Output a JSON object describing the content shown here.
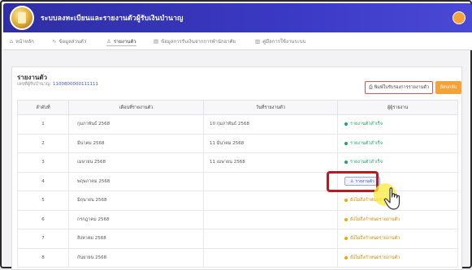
{
  "app": {
    "title": "ระบบลงทะเบียนและรายงานตัวผู้รับเงินบำนาญ"
  },
  "nav": {
    "items": [
      {
        "label": "หน้าหลัก",
        "icon": "home-icon",
        "glyph": "⌂"
      },
      {
        "label": "ข้อมูลส่วนตัว",
        "icon": "user-icon",
        "glyph": "∿"
      },
      {
        "label": "รายงานตัว",
        "icon": "person-icon",
        "glyph": "♙"
      },
      {
        "label": "ข้อมูลการรับเงินจากการพำนักอาศัย",
        "icon": "document-icon",
        "glyph": "▤"
      },
      {
        "label": "คู่มือการใช้งานระบบ",
        "icon": "book-icon",
        "glyph": "▥"
      }
    ]
  },
  "page": {
    "title": "รายงานตัว",
    "subtitle_prefix": "เลขที่ผู้รับบำนาญ:",
    "id_number": "1100800000111111",
    "print_button": "พิมพ์ใบรับรองการรายงานตัว",
    "orange_button": "ย้อนกลับ"
  },
  "table": {
    "headers": [
      "ลำดับที่",
      "เดือนที่รายงานตัว",
      "วันที่รายงานตัว",
      "ผู้ผู้รายงาน"
    ],
    "rows": [
      {
        "no": "1",
        "month": "กุมภาพันธ์ 2568",
        "date": "10 กุมภาพันธ์ 2568",
        "status": "รายงานตัวสำเร็จ",
        "type": "green"
      },
      {
        "no": "2",
        "month": "มีนาคม 2568",
        "date": "11 มีนาคม 2568",
        "status": "รายงานตัวสำเร็จ",
        "type": "green"
      },
      {
        "no": "3",
        "month": "เมษายน 2568",
        "date": "11 เมษายน 2568",
        "status": "รายงานตัวสำเร็จ",
        "type": "green"
      },
      {
        "no": "4",
        "month": "พฤษภาคม 2568",
        "date": "",
        "status": "รายงานตัว",
        "type": "button"
      },
      {
        "no": "5",
        "month": "มิถุนายน 2568",
        "date": "",
        "status": "ยังไม่ถึงกำหนดรายงานตัว",
        "type": "orange"
      },
      {
        "no": "6",
        "month": "กรกฎาคม 2568",
        "date": "",
        "status": "ยังไม่ถึงกำหนดรายงานตัว",
        "type": "orange"
      },
      {
        "no": "7",
        "month": "สิงหาคม 2568",
        "date": "",
        "status": "ยังไม่ถึงกำหนดรายงานตัว",
        "type": "orange"
      },
      {
        "no": "8",
        "month": "กันยายน 2568",
        "date": "",
        "status": "ยังไม่ถึงกำหนดรายงานตัว",
        "type": "orange"
      }
    ]
  },
  "colors": {
    "header_blue": "#3a39c4",
    "accent_orange": "#f6a23b",
    "status_green": "#21a366",
    "highlight_red": "#b21c25",
    "link_blue": "#3b57c2"
  }
}
